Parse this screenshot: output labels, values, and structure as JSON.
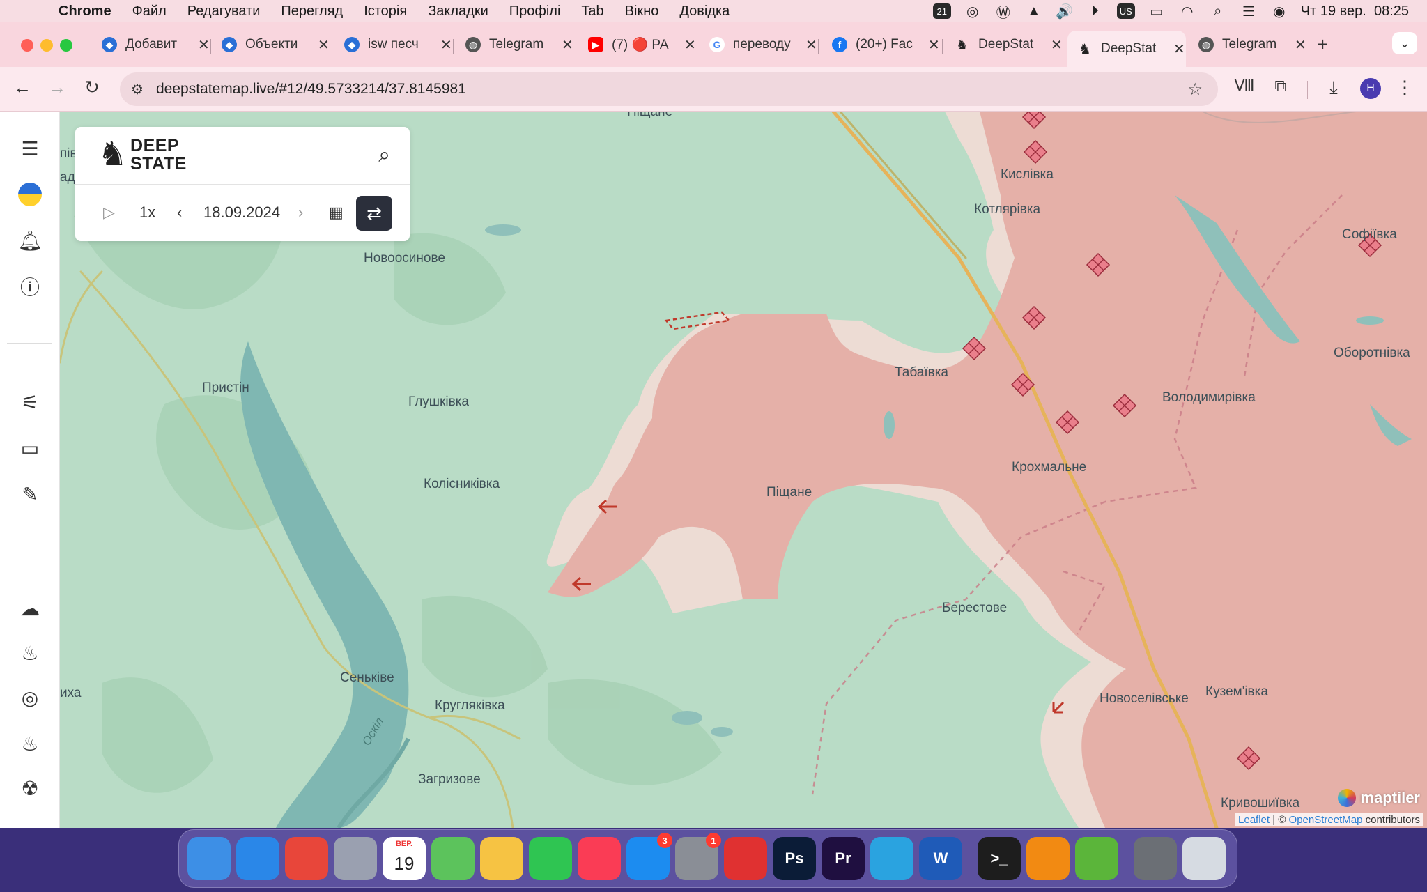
{
  "menubar": {
    "app": "Chrome",
    "items": [
      "Файл",
      "Редагувати",
      "Перегляд",
      "Історія",
      "Закладки",
      "Профілі",
      "Tab",
      "Вікно",
      "Довідка"
    ],
    "status_icons": [
      "cloud-icon",
      "creative-cloud-icon",
      "wordpress-icon",
      "vlc-icon",
      "volume-icon",
      "play-icon",
      "keyboard-layout-icon",
      "battery-icon",
      "wifi-icon",
      "search-icon",
      "control-center-icon",
      "siri-icon"
    ],
    "badge_count": "21",
    "input_source": "US",
    "datetime": "Чт 19 вер.  08:25"
  },
  "tabs": [
    {
      "label": "Добавит",
      "icon": "shield-icon",
      "color": "#2a6fd6"
    },
    {
      "label": "Объекти",
      "icon": "shield-icon",
      "color": "#2a6fd6"
    },
    {
      "label": "isw песч",
      "icon": "shield-icon",
      "color": "#2a6fd6"
    },
    {
      "label": "Telegram",
      "icon": "globe-icon",
      "color": "#555555"
    },
    {
      "label": "(7) 🔴 РА",
      "icon": "youtube-icon",
      "color": "#ff0000"
    },
    {
      "label": "переводу",
      "icon": "google-icon",
      "color": "#4285f4"
    },
    {
      "label": "(20+) Fac",
      "icon": "facebook-icon",
      "color": "#1877f2"
    },
    {
      "label": "DeepStat",
      "icon": "deepstate-icon",
      "color": "#222222"
    },
    {
      "label": "DeepStat",
      "icon": "deepstate-icon",
      "color": "#222222",
      "active": true
    },
    {
      "label": "Telegram",
      "icon": "globe-icon",
      "color": "#555555"
    }
  ],
  "address": {
    "url": "deepstatemap.live/#12/49.5733214/37.8145981",
    "profile_initial": "H"
  },
  "panel": {
    "logo_line1": "DEEP",
    "logo_line2": "STATE",
    "speed": "1x",
    "date": "18.09.2024"
  },
  "map": {
    "colors": {
      "occupied": "#e5b0a8",
      "contested": "#eddcd4",
      "land": "#b9dcc6",
      "water": "#7fb7b2"
    },
    "places": [
      {
        "name": "Піщане",
        "id": "p1"
      },
      {
        "name": "Кислівка",
        "id": "p2"
      },
      {
        "name": "Котлярівка",
        "id": "p3"
      },
      {
        "name": "Софіївка",
        "id": "p4"
      },
      {
        "name": "Новоосинове",
        "id": "p5"
      },
      {
        "name": "Оборотнівка",
        "id": "p6"
      },
      {
        "name": "Табаївка",
        "id": "p7"
      },
      {
        "name": "Пристін",
        "id": "p8"
      },
      {
        "name": "Глушківка",
        "id": "p9"
      },
      {
        "name": "Володимирівка",
        "id": "p10"
      },
      {
        "name": "Крохмальне",
        "id": "p11"
      },
      {
        "name": "Колісниківка",
        "id": "p12"
      },
      {
        "name": "Піщане",
        "id": "p13"
      },
      {
        "name": "Берестове",
        "id": "p14"
      },
      {
        "name": "Сеньківе",
        "id": "p15"
      },
      {
        "name": "Новоселівське",
        "id": "p16"
      },
      {
        "name": "Кузем'івка",
        "id": "p17"
      },
      {
        "name": "Кругляківка",
        "id": "p18"
      },
      {
        "name": "Загризове",
        "id": "p19"
      },
      {
        "name": "Кривошиївка",
        "id": "p20"
      },
      {
        "name": "иха",
        "id": "p21"
      },
      {
        "name": "пів",
        "id": "p22"
      },
      {
        "name": "ади",
        "id": "p23"
      },
      {
        "name": "Оскіл",
        "id": "p24"
      }
    ],
    "attribution": {
      "leaflet": "Leaflet",
      "osm": "OpenStreetMap",
      "suffix": "contributors"
    },
    "maptiler": "maptiler"
  },
  "dock": {
    "apps": [
      {
        "name": "Finder",
        "icon": "finder-icon",
        "color": "#3d8fe6"
      },
      {
        "name": "Safari",
        "icon": "safari-icon",
        "color": "#2a87e8"
      },
      {
        "name": "Chrome",
        "icon": "chrome-icon",
        "color": "#e8463a"
      },
      {
        "name": "Launchpad",
        "icon": "launchpad-icon",
        "color": "#9aa0b0"
      },
      {
        "name": "Calendar",
        "icon": "calendar-icon",
        "color": "#ffffff",
        "text": "19",
        "sub": "ВЕР."
      },
      {
        "name": "Maps",
        "icon": "maps-icon",
        "color": "#5cc35c"
      },
      {
        "name": "Photos",
        "icon": "photos-icon",
        "color": "#f6c343"
      },
      {
        "name": "FaceTime",
        "icon": "facetime-icon",
        "color": "#2fc552"
      },
      {
        "name": "Music",
        "icon": "music-icon",
        "color": "#fa3c55"
      },
      {
        "name": "App Store",
        "icon": "appstore-icon",
        "color": "#1c8cf0",
        "badge": "3"
      },
      {
        "name": "System Settings",
        "icon": "settings-icon",
        "color": "#8a8e96",
        "badge": "1"
      },
      {
        "name": "AdBlock",
        "icon": "adblock-icon",
        "color": "#e03131"
      },
      {
        "name": "Photoshop",
        "icon": "photoshop-icon",
        "color": "#0b1c37",
        "text": "Ps"
      },
      {
        "name": "Premiere",
        "icon": "premiere-icon",
        "color": "#1f0f40",
        "text": "Pr"
      },
      {
        "name": "Telegram",
        "icon": "telegram-icon",
        "color": "#2aa3e0"
      },
      {
        "name": "Word",
        "icon": "word-icon",
        "color": "#1f5bb8",
        "text": "W"
      },
      {
        "name": "Terminal",
        "icon": "terminal-icon",
        "color": "#1d1d1d",
        "text": ">_"
      },
      {
        "name": "VLC",
        "icon": "vlc-icon",
        "color": "#f28a12"
      },
      {
        "name": "uTorrent",
        "icon": "utorrent-icon",
        "color": "#5bb53a"
      },
      {
        "name": "Archive",
        "icon": "archive-icon",
        "color": "#6b6f75"
      },
      {
        "name": "Trash",
        "icon": "trash-icon",
        "color": "#d6dbe2"
      }
    ]
  }
}
